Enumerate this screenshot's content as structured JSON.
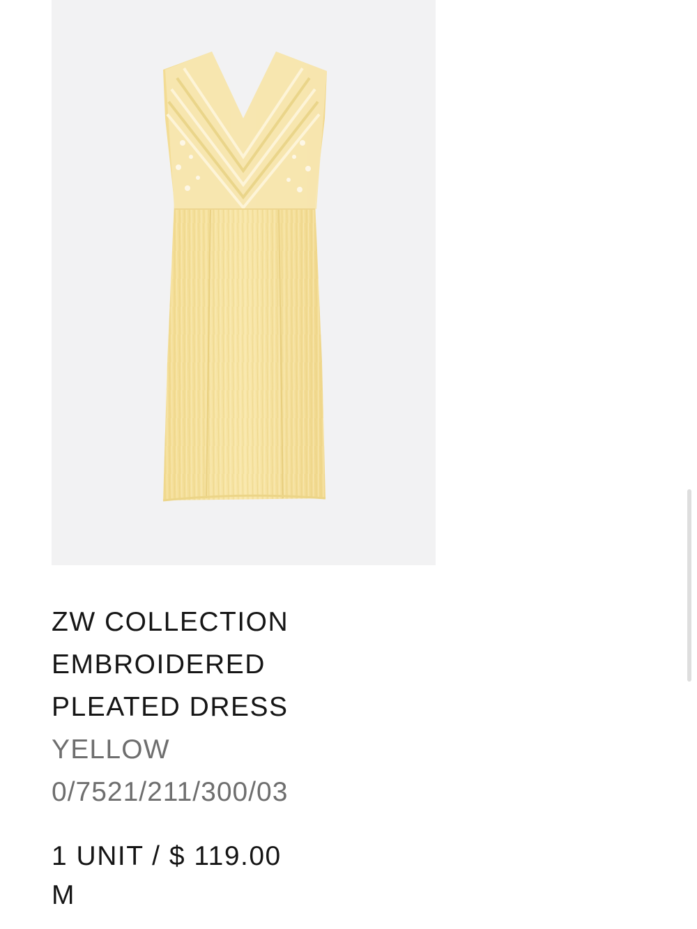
{
  "product": {
    "image_alt": "ZW COLLECTION EMBROIDERED PLEATED DRESS",
    "title_lines": [
      "ZW COLLECTION",
      "EMBROIDERED",
      "PLEATED DRESS"
    ],
    "color": "YELLOW",
    "reference": "0/7521/211/300/03",
    "quantity_price": "1 UNIT / $ 119.00",
    "size": "M"
  },
  "colors": {
    "image_background": "#f2f2f3",
    "dress": "#f6e3a2",
    "text_primary": "#151515",
    "text_secondary": "#6e6e6e"
  }
}
